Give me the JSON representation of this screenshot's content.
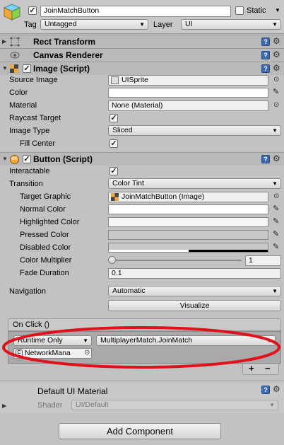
{
  "header": {
    "object_name": "JoinMatchButton",
    "static_label": "Static",
    "tag_label": "Tag",
    "tag_value": "Untagged",
    "layer_label": "Layer",
    "layer_value": "UI"
  },
  "rect_transform": {
    "title": "Rect Transform"
  },
  "canvas_renderer": {
    "title": "Canvas Renderer"
  },
  "image": {
    "title": "Image (Script)",
    "source_image_label": "Source Image",
    "source_image_value": "UISprite",
    "color_label": "Color",
    "material_label": "Material",
    "material_value": "None (Material)",
    "raycast_label": "Raycast Target",
    "image_type_label": "Image Type",
    "image_type_value": "Sliced",
    "fill_center_label": "Fill Center"
  },
  "button": {
    "title": "Button (Script)",
    "interactable_label": "Interactable",
    "transition_label": "Transition",
    "transition_value": "Color Tint",
    "target_graphic_label": "Target Graphic",
    "target_graphic_value": "JoinMatchButton (Image)",
    "normal_color_label": "Normal Color",
    "highlighted_color_label": "Highlighted Color",
    "pressed_color_label": "Pressed Color",
    "disabled_color_label": "Disabled Color",
    "color_multiplier_label": "Color Multiplier",
    "color_multiplier_value": "1",
    "color_multiplier_fraction": 0.0,
    "fade_duration_label": "Fade Duration",
    "fade_duration_value": "0.1",
    "navigation_label": "Navigation",
    "navigation_value": "Automatic",
    "visualize_label": "Visualize"
  },
  "on_click": {
    "title": "On Click ()",
    "runtime_value": "Runtime Only",
    "function_value": "MultiplayerMatch.JoinMatch",
    "object_value": "NetworkMana",
    "plus_label": "+",
    "minus_label": "−"
  },
  "material_footer": {
    "name": "Default UI Material",
    "shader_label": "Shader",
    "shader_value": "UI/Default"
  },
  "add_component_label": "Add Component",
  "colors": {
    "background": "#c2c2c2",
    "header_bg": "#b9b9b9",
    "annotation_red": "#e0111a",
    "help_blue": "#3d6bb0"
  },
  "icons": {
    "gameobject": "cube-icon",
    "rect_transform": "rect-transform-icon",
    "canvas_renderer": "eye-icon",
    "image": "image-icon",
    "button": "ok-button-icon",
    "help": "help-icon",
    "gear": "gear-icon",
    "picker": "object-picker-icon",
    "eyedropper": "eyedropper-icon"
  }
}
